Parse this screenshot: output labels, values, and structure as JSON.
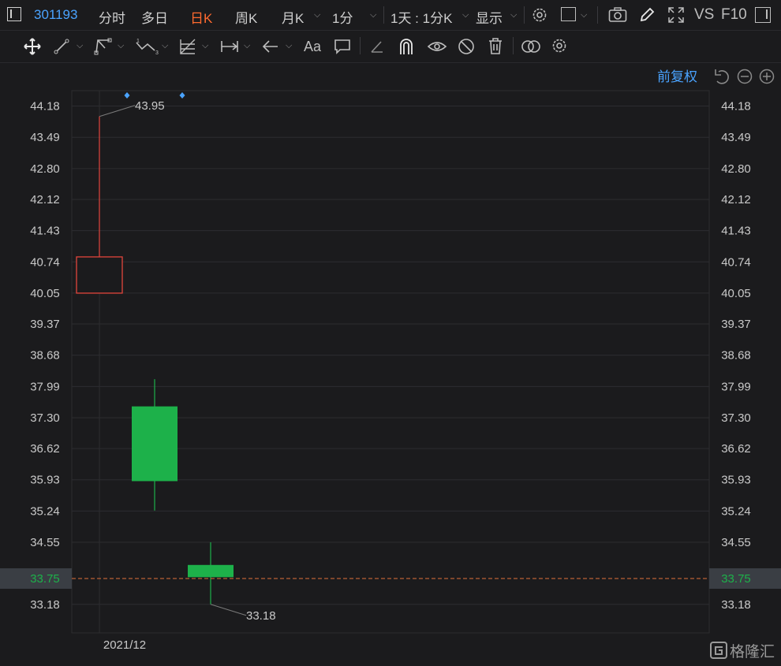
{
  "toolbar": {
    "code": "301193",
    "tabs": [
      "分时",
      "多日",
      "日K",
      "周K",
      "月K",
      "1分"
    ],
    "active_tab": "日K",
    "range_label": "1天 : 1分K",
    "display_label": "显示",
    "vs_label": "VS",
    "f10_label": "F10"
  },
  "drawing_tools": [
    "move-icon",
    "line-icon",
    "channel-icon",
    "wave-icon",
    "fib-icon",
    "measure-icon",
    "arrow-icon",
    "text-icon",
    "comment-icon",
    "pen-icon",
    "magnet-icon",
    "eye-icon",
    "hide-icon",
    "trash-icon",
    "overlap-icon",
    "settings-icon"
  ],
  "drawing_text_tool_label": "Aa",
  "chart_header": {
    "adjust_label": "前复权"
  },
  "colors": {
    "up": "#e2453c",
    "down": "#1db14a",
    "accent": "#4aa3ff",
    "active_tab": "#ff6a2f",
    "price_line": "#e0703a"
  },
  "chart_data": {
    "type": "candlestick",
    "y_ticks": [
      44.18,
      43.49,
      42.8,
      42.12,
      41.43,
      40.74,
      40.05,
      39.37,
      38.68,
      37.99,
      37.3,
      36.62,
      35.93,
      35.24,
      34.55,
      33.18
    ],
    "ylim": [
      32.55,
      44.52
    ],
    "x_label": "2021/12",
    "candles": [
      {
        "open": 40.05,
        "close": 40.85,
        "high": 43.95,
        "low": 40.05,
        "direction": "up"
      },
      {
        "open": 37.55,
        "close": 35.9,
        "high": 38.15,
        "low": 35.25,
        "direction": "down"
      },
      {
        "open": 34.05,
        "close": 33.78,
        "high": 34.55,
        "low": 33.18,
        "direction": "down"
      }
    ],
    "markers_above": [
      0.5,
      1.5
    ],
    "annotations": [
      {
        "candle": 0,
        "text": "43.95",
        "value": 43.95
      },
      {
        "candle": 2,
        "text": "33.18",
        "value": 33.18
      }
    ],
    "current_price": "33.75",
    "current_value": 33.75
  },
  "watermark": "格隆汇"
}
